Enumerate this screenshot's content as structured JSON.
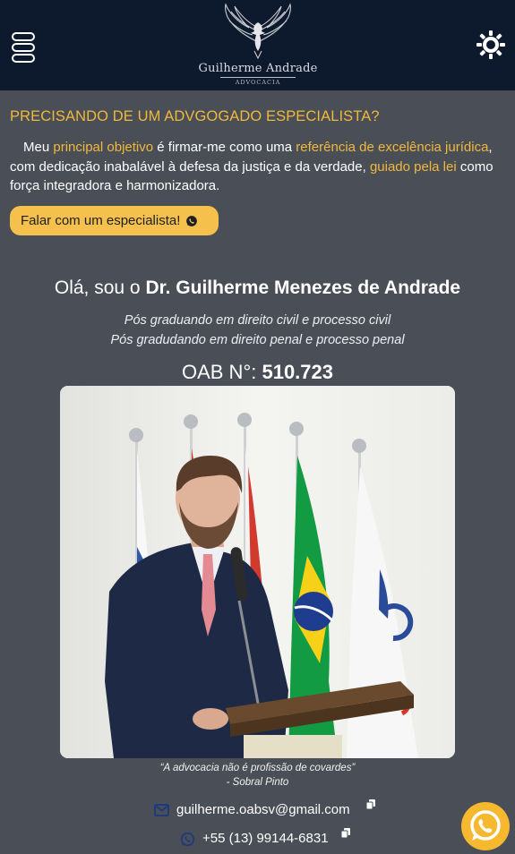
{
  "header": {
    "logo_name": "Guilherme Andrade",
    "logo_subtitle": "ADVOCACIA",
    "menu_icon": "menu-icon",
    "theme_icon": "sun-icon"
  },
  "intro": {
    "title": "PRECISANDO DE UM ADVGOGADO ESPECIALISTA?",
    "text_parts": [
      "Meu ",
      "principal objetivo",
      " é firmar-me como uma ",
      "referência de excelência jurídica",
      ", com dedicação inabalável à defesa da justiça e da verdade, ",
      "guiado pela lei",
      " como força integradora e harmonizadora."
    ],
    "cta_label": "Falar com um especialista!"
  },
  "profile": {
    "greeting_prefix": "Olá, sou o ",
    "name": "Dr. Guilherme Menezes de Andrade",
    "credentials": [
      "Pós graduando em direito civil e processo civil",
      "Pós gradudando em direito penal e processo penal"
    ],
    "oab_label": "OAB N°: ",
    "oab_number": "510.723",
    "quote": "“A advocacia não é profissão de covardes”",
    "quote_author": "- Sobral Pinto"
  },
  "contact": {
    "email": "guilherme.oabsv@gmail.com",
    "phone": "+55 (13) 99144-6831"
  },
  "colors": {
    "accent": "#f0b93a",
    "header_bg": "#0d1a2e",
    "page_bg": "#4a4e57",
    "button_bg": "#f5c04b"
  }
}
